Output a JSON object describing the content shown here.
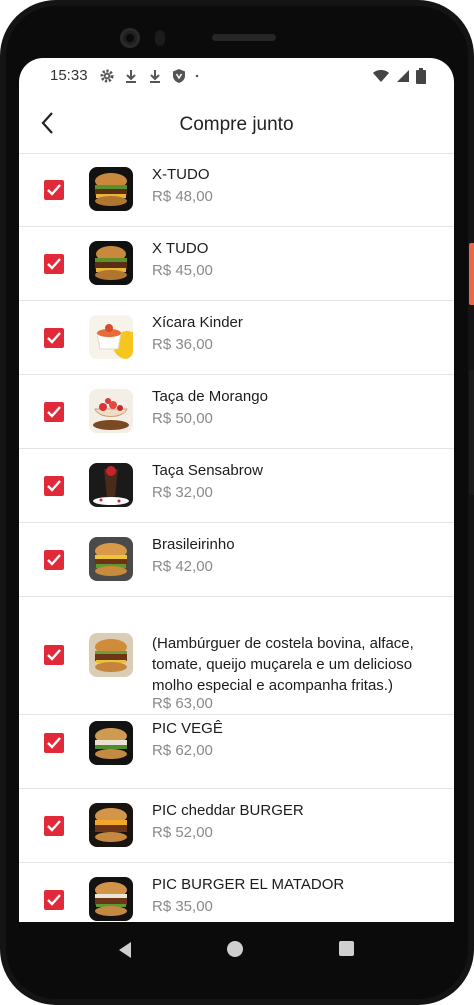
{
  "status_bar": {
    "time": "15:33",
    "icons": [
      "gear-icon",
      "download-icon",
      "download-icon",
      "shield-icon",
      "dot-icon"
    ],
    "right_icons": [
      "wifi-icon",
      "signal-icon",
      "battery-icon"
    ]
  },
  "header": {
    "title": "Compre junto",
    "back_icon": "chevron-left-icon"
  },
  "colors": {
    "checkbox": "#e02a3a",
    "divider": "#e4e4e4",
    "price": "#8a8a8a"
  },
  "items": [
    {
      "name": "X-TUDO",
      "price": "R$ 48,00",
      "checked": true
    },
    {
      "name": "X TUDO",
      "price": "R$ 45,00",
      "checked": true
    },
    {
      "name": "Xícara Kinder",
      "price": "R$ 36,00",
      "checked": true
    },
    {
      "name": "Taça de Morango",
      "price": "R$ 50,00",
      "checked": true
    },
    {
      "name": "Taça Sensabrow",
      "price": "R$ 32,00",
      "checked": true
    },
    {
      "name": "Brasileirinho",
      "price": "R$ 42,00",
      "checked": true
    },
    {
      "name": "(Hambúrguer de costela bovina, alface, tomate, queijo muçarela e um delicioso molho especial e acompanha fritas.)",
      "price": "R$ 63,00",
      "checked": true
    },
    {
      "name": "PIC VEGÊ",
      "price": "R$ 62,00",
      "checked": true
    },
    {
      "name": "PIC cheddar BURGER",
      "price": "R$ 52,00",
      "checked": true
    },
    {
      "name": "PIC BURGER EL MATADOR",
      "price": "R$ 35,00",
      "checked": true
    }
  ],
  "nav": {
    "back": "nav-back-icon",
    "home": "nav-home-icon",
    "recent": "nav-recent-icon"
  }
}
